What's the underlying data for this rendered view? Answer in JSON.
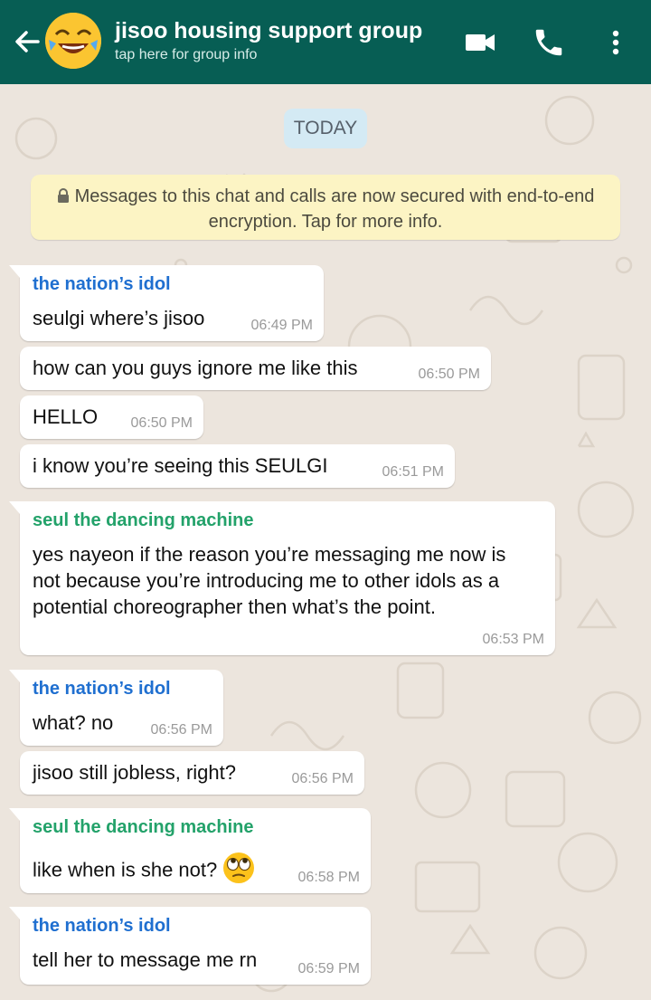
{
  "header": {
    "title": "jisoo housing support group",
    "subtitle": "tap here for group info",
    "icons": [
      "back-arrow-icon",
      "group-avatar",
      "video-call-icon",
      "voice-call-icon",
      "more-vert-icon"
    ],
    "colors": {
      "bar": "#075e54"
    }
  },
  "date_chip": "TODAY",
  "notice": "Messages to this chat and calls are now secured with end-to-end encryption. Tap for more info.",
  "senders": {
    "nayeon": {
      "name": "the nation’s idol",
      "color": "#1f6fd0"
    },
    "seulgi": {
      "name": "seul the dancing machine",
      "color": "#23a26a"
    }
  },
  "messages": [
    {
      "sender": "the nation’s idol",
      "text": "seulgi where’s jisoo",
      "time": "06:49 PM"
    },
    {
      "text": "how can you guys ignore me like this",
      "time": "06:50 PM"
    },
    {
      "text": "HELLO",
      "time": "06:50 PM"
    },
    {
      "text": "i know you’re seeing this SEULGI",
      "time": "06:51 PM"
    },
    {
      "sender": "seul the dancing machine",
      "text": "yes nayeon if the reason you’re messaging me now is not because you’re introducing me to other idols as a potential choreographer then what’s the point.",
      "time": "06:53 PM"
    },
    {
      "sender": "the nation’s idol",
      "text": "what? no",
      "time": "06:56 PM"
    },
    {
      "text": "jisoo still jobless, right?",
      "time": "06:56 PM"
    },
    {
      "sender": "seul the dancing machine",
      "text": "like when is she not?",
      "emoji": "face-with-rolling-eyes-emoji",
      "time": "06:58 PM"
    },
    {
      "sender": "the nation’s idol",
      "text": "tell her to message me rn",
      "time": "06:59 PM"
    }
  ]
}
